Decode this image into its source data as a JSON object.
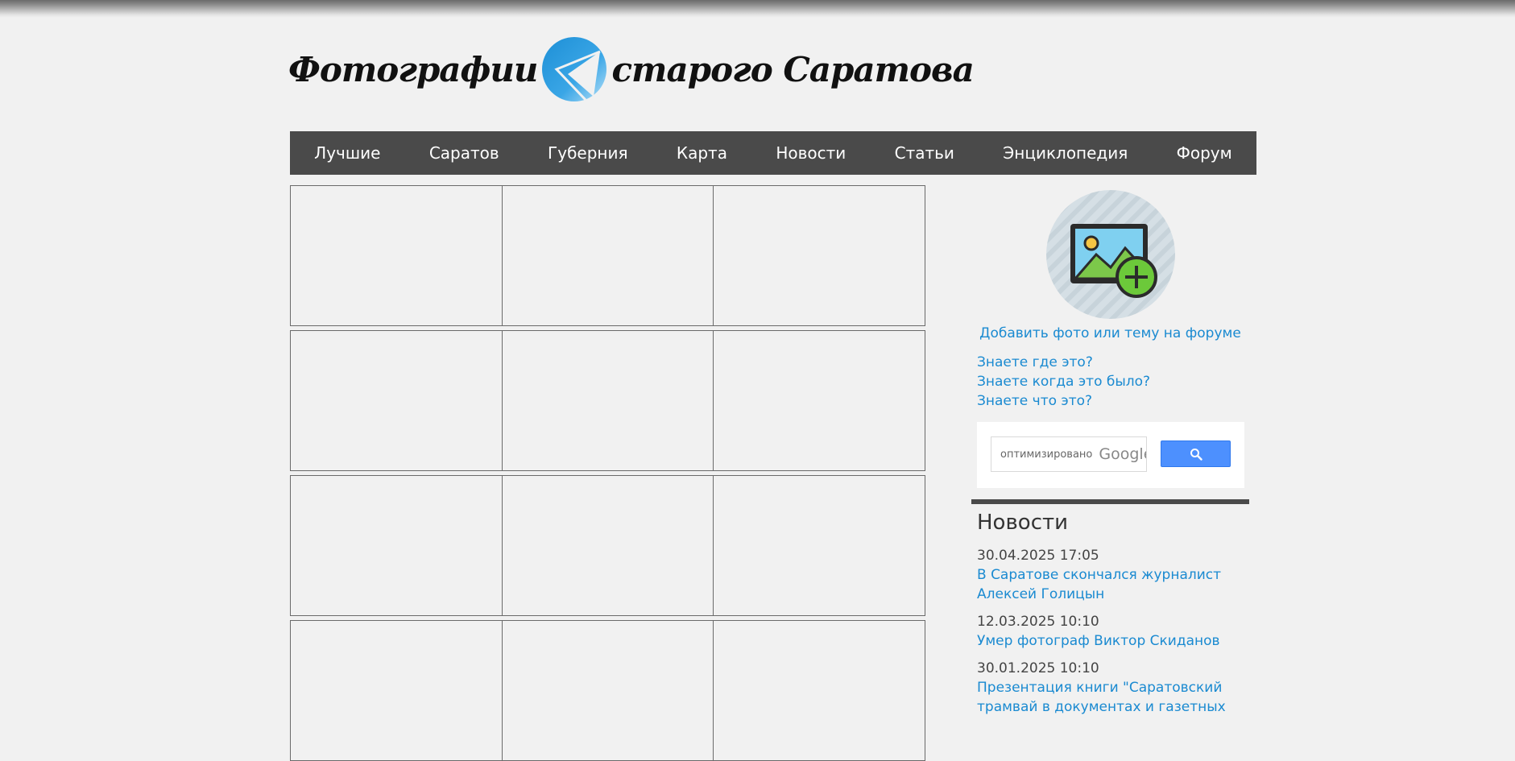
{
  "logo": {
    "left_text": "Фотографии",
    "right_text": "старого Саратова"
  },
  "nav": {
    "items": [
      "Лучшие",
      "Саратов",
      "Губерния",
      "Карта",
      "Новости",
      "Статьи",
      "Энциклопедия",
      "Форум"
    ]
  },
  "sidebar": {
    "add_photo_link": "Добавить фото или тему на форуме",
    "know_where": "Знаете где это?",
    "know_when": "Знаете когда это было?",
    "know_what": "Знаете что это?",
    "search": {
      "placeholder": "оптимизировано",
      "brand": "Google"
    },
    "news": {
      "title": "Новости",
      "items": [
        {
          "date": "30.04.2025 17:05",
          "text": "В Саратове скончался журналист Алексей Голицын"
        },
        {
          "date": "12.03.2025 10:10",
          "text": "Умер фотограф Виктор Скиданов"
        },
        {
          "date": "30.01.2025 10:10",
          "text": "Презентация книги \"Саратовский трамвай в документах и газетных"
        }
      ]
    }
  },
  "colors": {
    "nav_bg": "#4a4a4a",
    "link": "#1a8ad1",
    "search_button": "#4d90fe",
    "page_bg": "#f1f1f1"
  }
}
